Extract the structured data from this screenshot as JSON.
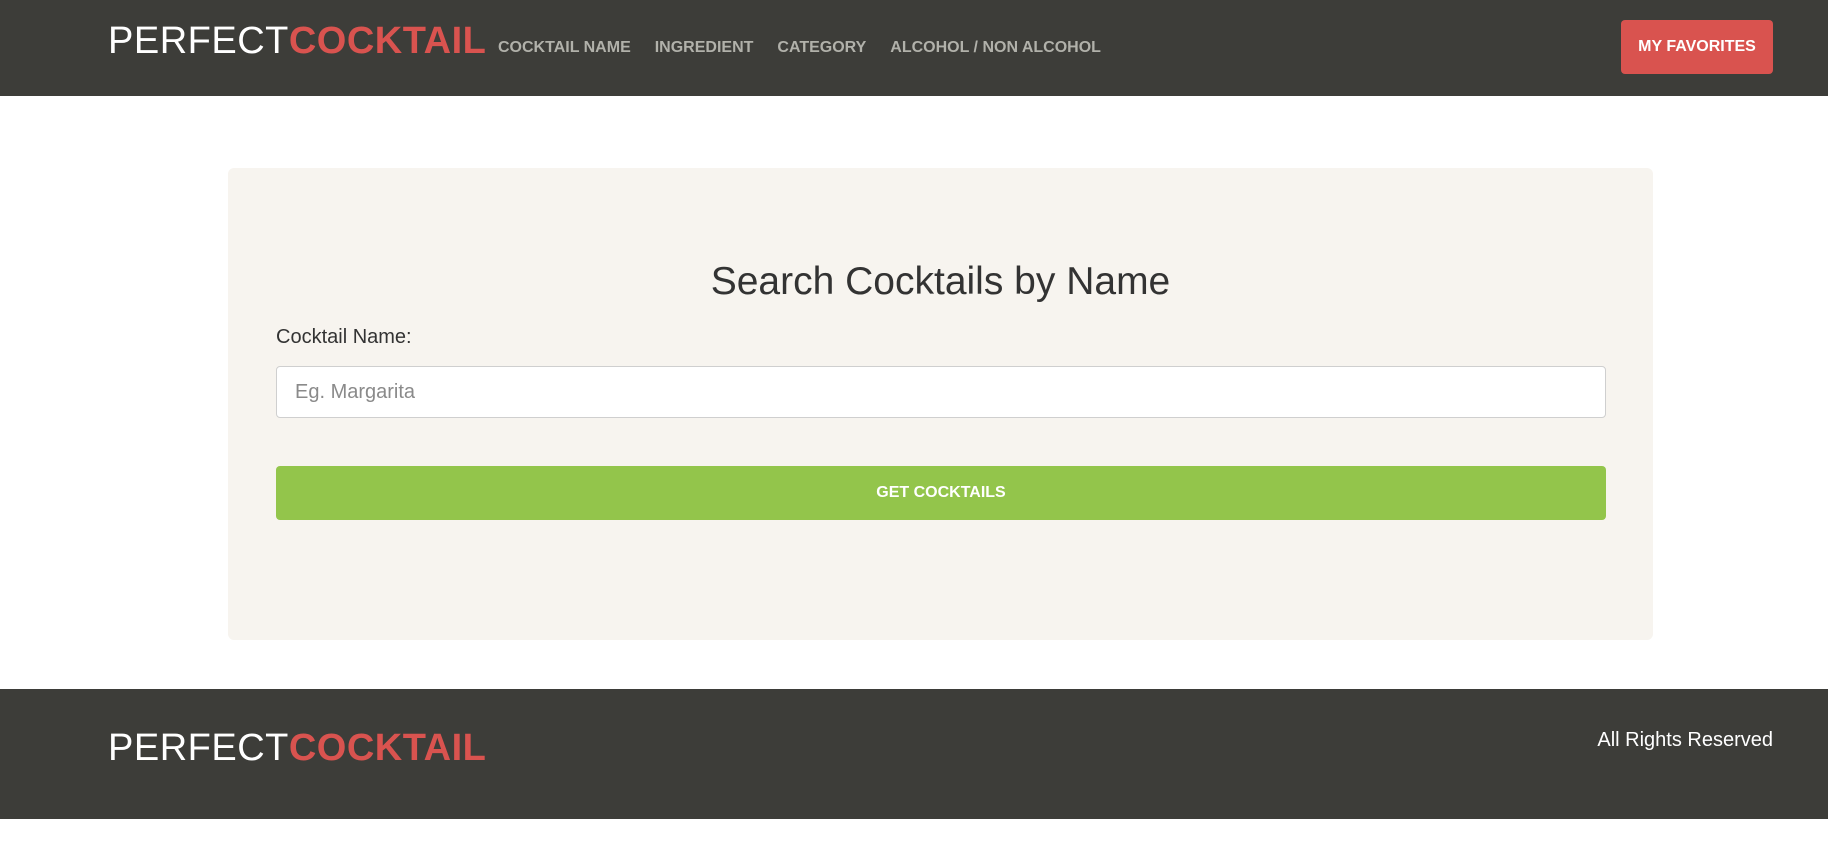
{
  "header": {
    "logo_light": "PERFECT",
    "logo_bold": "COCKTAIL",
    "nav": [
      {
        "label": "COCKTAIL NAME"
      },
      {
        "label": "INGREDIENT"
      },
      {
        "label": "CATEGORY"
      },
      {
        "label": "ALCOHOL / NON ALCOHOL"
      }
    ],
    "favorites_label": "MY FAVORITES"
  },
  "search": {
    "title": "Search Cocktails by Name",
    "label": "Cocktail Name:",
    "value": "",
    "placeholder": "Eg. Margarita",
    "button_label": "GET COCKTAILS"
  },
  "footer": {
    "logo_light": "PERFECT",
    "logo_bold": "COCKTAIL",
    "rights": "All Rights Reserved"
  },
  "colors": {
    "dark_bg": "#3d3d39",
    "accent_red": "#d9534f",
    "accent_green": "#93c54b",
    "card_bg": "#f7f4ef",
    "nav_text": "#b1b1aa"
  }
}
